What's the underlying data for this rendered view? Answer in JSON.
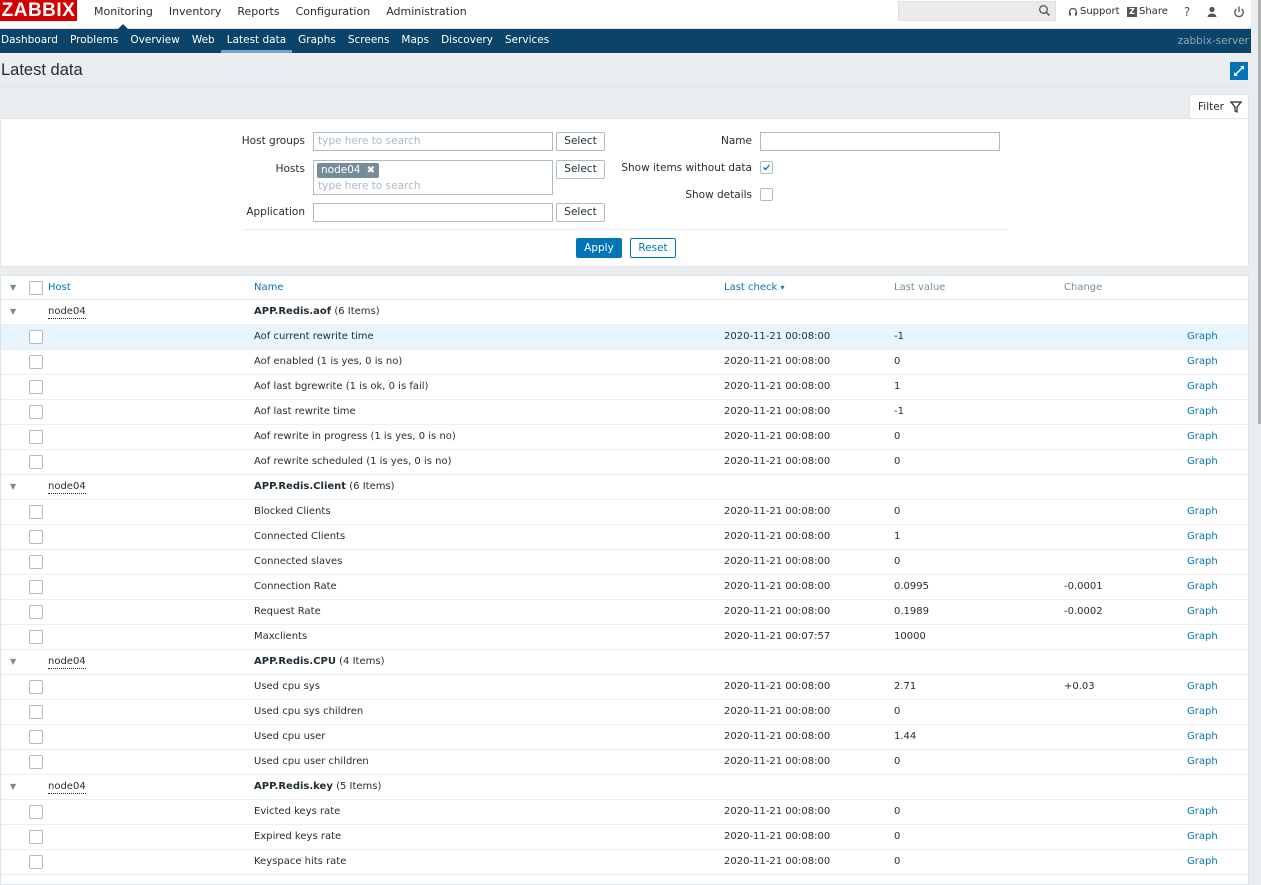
{
  "header": {
    "logo": "ZABBIX",
    "menu": [
      {
        "label": "Monitoring",
        "active": true
      },
      {
        "label": "Inventory",
        "active": false
      },
      {
        "label": "Reports",
        "active": false
      },
      {
        "label": "Configuration",
        "active": false
      },
      {
        "label": "Administration",
        "active": false
      }
    ],
    "search_value": "",
    "support_label": "Support",
    "share_label": "Share",
    "help_label": "?"
  },
  "subnav": {
    "items": [
      {
        "label": "Dashboard",
        "active": false
      },
      {
        "label": "Problems",
        "active": false
      },
      {
        "label": "Overview",
        "active": false
      },
      {
        "label": "Web",
        "active": false
      },
      {
        "label": "Latest data",
        "active": true
      },
      {
        "label": "Graphs",
        "active": false
      },
      {
        "label": "Screens",
        "active": false
      },
      {
        "label": "Maps",
        "active": false
      },
      {
        "label": "Discovery",
        "active": false
      },
      {
        "label": "Services",
        "active": false
      }
    ],
    "server_name": "zabbix-server"
  },
  "page": {
    "title": "Latest data"
  },
  "filter": {
    "tab_label": "Filter",
    "host_groups_label": "Host groups",
    "host_groups_placeholder": "type here to search",
    "hosts_label": "Hosts",
    "hosts_selected": "node04",
    "hosts_placeholder": "type here to search",
    "application_label": "Application",
    "application_value": "",
    "select_label": "Select",
    "name_label": "Name",
    "name_value": "",
    "show_without_data_label": "Show items without data",
    "show_without_data_checked": true,
    "show_details_label": "Show details",
    "show_details_checked": false,
    "apply_label": "Apply",
    "reset_label": "Reset"
  },
  "table": {
    "columns": {
      "host": "Host",
      "name": "Name",
      "last_check": "Last check",
      "last_value": "Last value",
      "change": "Change"
    },
    "sort_indicator": "▾",
    "graph_label": "Graph",
    "groups": [
      {
        "host": "node04",
        "app": "APP.Redis.aof",
        "count": "(6 Items)",
        "items": [
          {
            "name": "Aof current rewrite time",
            "last_check": "2020-11-21 00:08:00",
            "last_value": "-1",
            "change": "",
            "highlighted": true
          },
          {
            "name": "Aof enabled (1 is yes, 0 is no)",
            "last_check": "2020-11-21 00:08:00",
            "last_value": "0",
            "change": ""
          },
          {
            "name": "Aof last bgrewrite (1 is ok, 0 is fail)",
            "last_check": "2020-11-21 00:08:00",
            "last_value": "1",
            "change": ""
          },
          {
            "name": "Aof last rewrite time",
            "last_check": "2020-11-21 00:08:00",
            "last_value": "-1",
            "change": ""
          },
          {
            "name": "Aof rewrite in progress (1 is yes, 0 is no)",
            "last_check": "2020-11-21 00:08:00",
            "last_value": "0",
            "change": ""
          },
          {
            "name": "Aof rewrite scheduled (1 is yes, 0 is no)",
            "last_check": "2020-11-21 00:08:00",
            "last_value": "0",
            "change": ""
          }
        ]
      },
      {
        "host": "node04",
        "app": "APP.Redis.Client",
        "count": "(6 Items)",
        "items": [
          {
            "name": "Blocked Clients",
            "last_check": "2020-11-21 00:08:00",
            "last_value": "0",
            "change": ""
          },
          {
            "name": "Connected Clients",
            "last_check": "2020-11-21 00:08:00",
            "last_value": "1",
            "change": ""
          },
          {
            "name": "Connected slaves",
            "last_check": "2020-11-21 00:08:00",
            "last_value": "0",
            "change": ""
          },
          {
            "name": "Connection Rate",
            "last_check": "2020-11-21 00:08:00",
            "last_value": "0.0995",
            "change": "-0.0001"
          },
          {
            "name": "Request Rate",
            "last_check": "2020-11-21 00:08:00",
            "last_value": "0.1989",
            "change": "-0.0002"
          },
          {
            "name": "Maxclients",
            "last_check": "2020-11-21 00:07:57",
            "last_value": "10000",
            "change": ""
          }
        ]
      },
      {
        "host": "node04",
        "app": "APP.Redis.CPU",
        "count": "(4 Items)",
        "items": [
          {
            "name": "Used cpu sys",
            "last_check": "2020-11-21 00:08:00",
            "last_value": "2.71",
            "change": "+0.03"
          },
          {
            "name": "Used cpu sys children",
            "last_check": "2020-11-21 00:08:00",
            "last_value": "0",
            "change": ""
          },
          {
            "name": "Used cpu user",
            "last_check": "2020-11-21 00:08:00",
            "last_value": "1.44",
            "change": ""
          },
          {
            "name": "Used cpu user children",
            "last_check": "2020-11-21 00:08:00",
            "last_value": "0",
            "change": ""
          }
        ]
      },
      {
        "host": "node04",
        "app": "APP.Redis.key",
        "count": "(5 Items)",
        "items": [
          {
            "name": "Evicted keys rate",
            "last_check": "2020-11-21 00:08:00",
            "last_value": "0",
            "change": ""
          },
          {
            "name": "Expired keys rate",
            "last_check": "2020-11-21 00:08:00",
            "last_value": "0",
            "change": ""
          },
          {
            "name": "Keyspace hits rate",
            "last_check": "2020-11-21 00:08:00",
            "last_value": "0",
            "change": ""
          }
        ]
      }
    ]
  },
  "colors": {
    "brand_red": "#d40000",
    "nav_blue": "#0b4468",
    "link_blue": "#0275b8",
    "hover_row": "#e8f5ff"
  }
}
